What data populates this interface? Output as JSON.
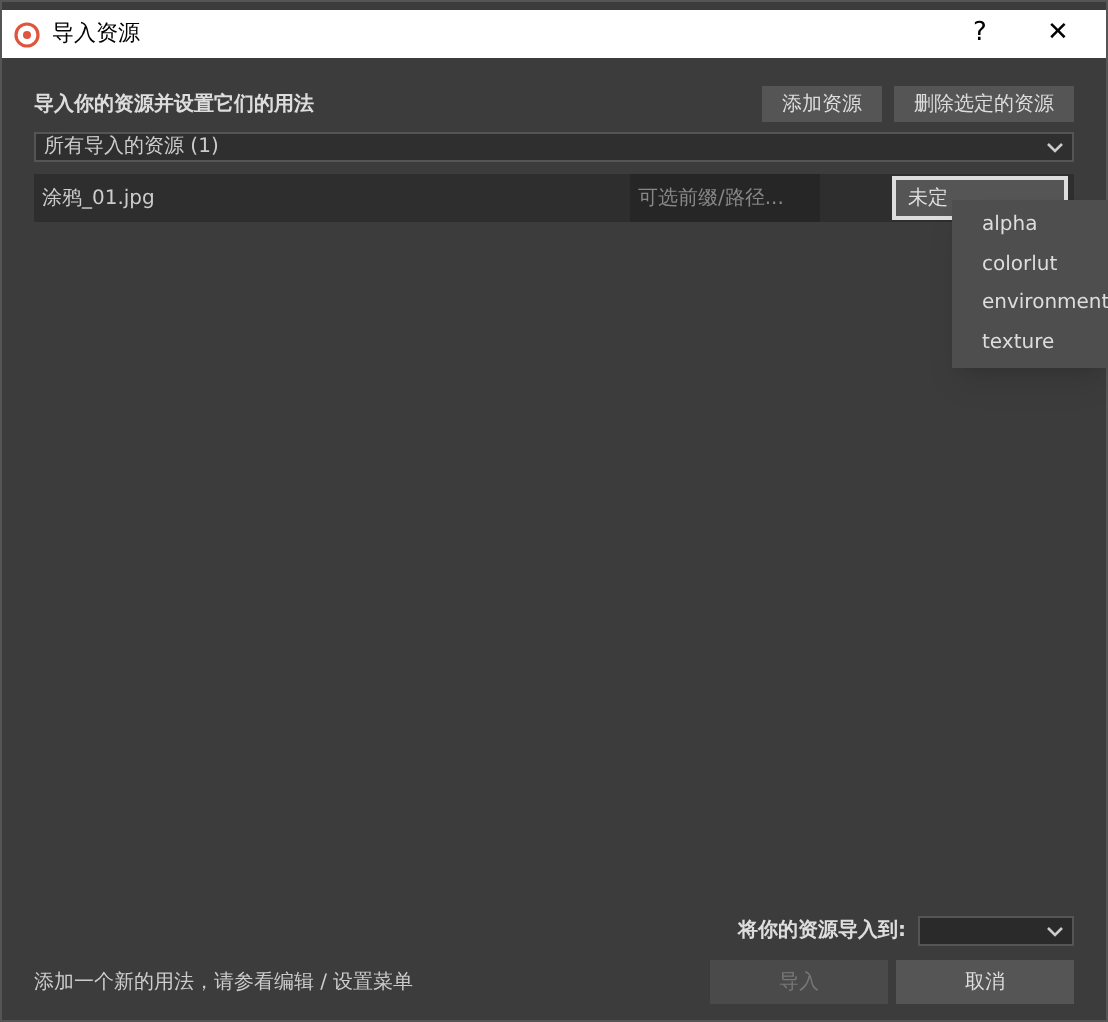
{
  "window": {
    "title": "导入资源",
    "help": "?",
    "close": "✕"
  },
  "header": {
    "label": "导入你的资源并设置它们的用法",
    "buttons": [
      {
        "label": "添加资源",
        "disabled": false
      },
      {
        "label": "删除选定的资源",
        "disabled": false
      }
    ]
  },
  "filter": {
    "value": "所有导入的资源 (1)"
  },
  "assets": [
    {
      "name": "涂鸦_01.jpg",
      "prefix_placeholder": "可选前缀/路径...",
      "usage": "未定",
      "expanded": true
    }
  ],
  "usage_menu": [
    {
      "label": "alpha"
    },
    {
      "label": "colorlut"
    },
    {
      "label": "environment"
    },
    {
      "label": "texture"
    }
  ],
  "footer": {
    "hint": "添加一个新的用法，请参看编辑 / 设置菜单",
    "target_label": "将你的资源导入到:",
    "buttons": [
      {
        "label": "导入",
        "disabled": true
      },
      {
        "label": "取消",
        "disabled": false
      }
    ]
  }
}
